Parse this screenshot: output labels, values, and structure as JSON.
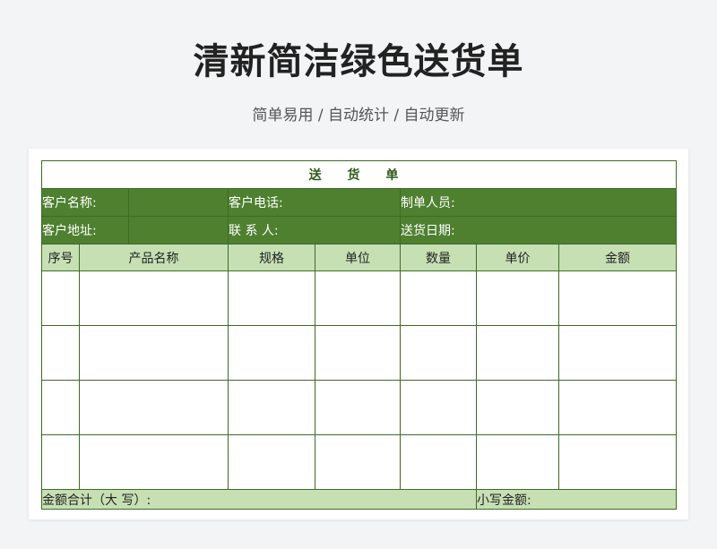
{
  "page": {
    "title": "清新简洁绿色送货单",
    "subtitle": "简单易用 / 自动统计 / 自动更新"
  },
  "sheet": {
    "title": "送 货 单",
    "info_rows": [
      [
        "客户名称:",
        "",
        "客户电话:",
        "制单人员:"
      ],
      [
        "客户地址:",
        "",
        "联 系 人:",
        "送货日期:"
      ]
    ],
    "headers": [
      "序号",
      "产品名称",
      "规格",
      "单位",
      "数量",
      "单价",
      "金额"
    ],
    "rows": [
      [
        "",
        "",
        "",
        "",
        "",
        "",
        ""
      ],
      [
        "",
        "",
        "",
        "",
        "",
        "",
        ""
      ],
      [
        "",
        "",
        "",
        "",
        "",
        "",
        ""
      ],
      [
        "",
        "",
        "",
        "",
        "",
        "",
        ""
      ]
    ],
    "total_upper_label": "金额合计（大 写）:",
    "total_lower_label": "小写金额:"
  },
  "colors": {
    "header_green": "#4e8030",
    "light_green": "#c6e0b4",
    "border": "#3d6b25",
    "title_text": "#2f5a16"
  }
}
